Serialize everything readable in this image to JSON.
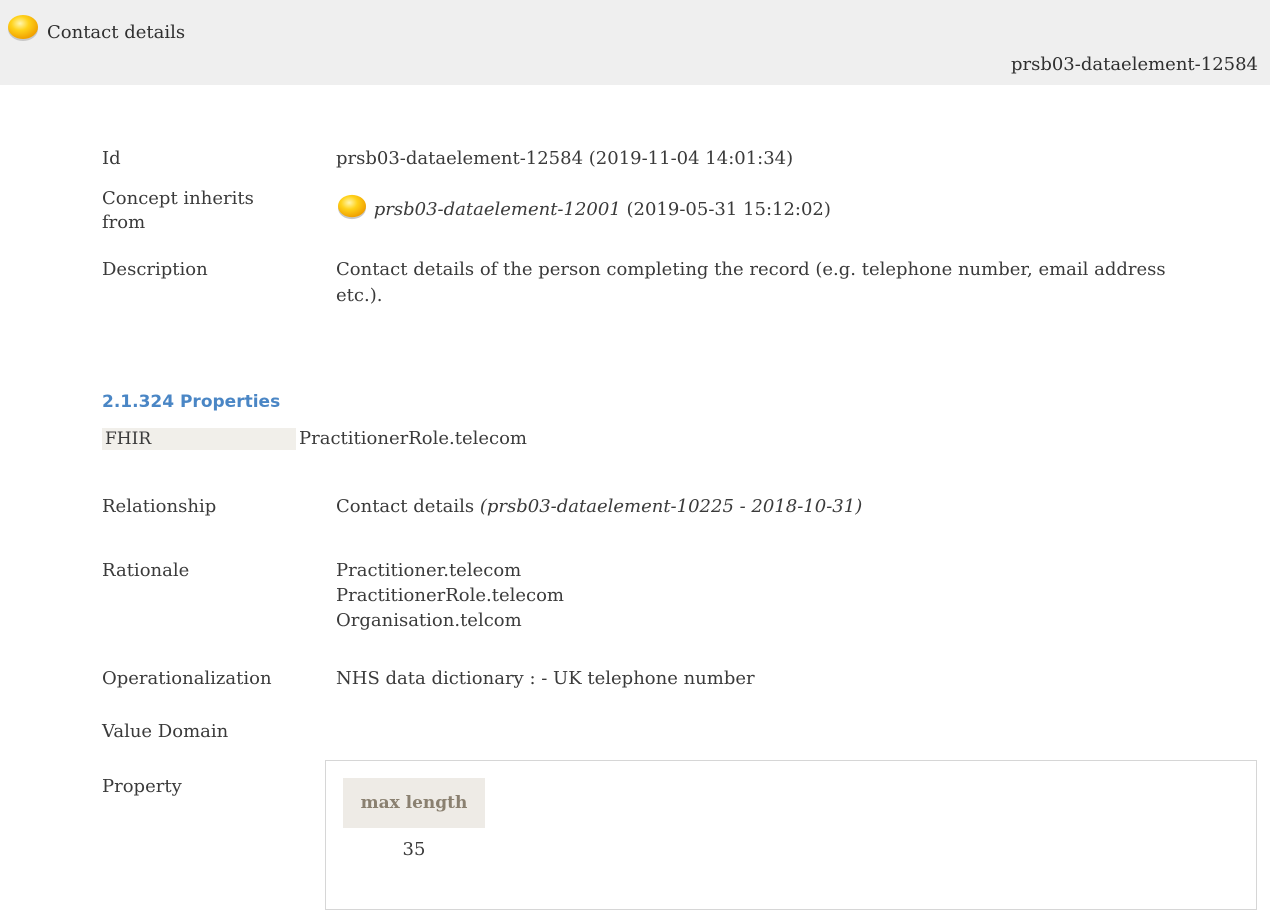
{
  "header": {
    "title": "Contact details",
    "right_id": "prsb03-dataelement-12584",
    "status_icon": "status-orb-yellow-icon"
  },
  "concept": {
    "id_label": "Id",
    "id_value": "prsb03-dataelement-12584 (2019-11-04 14:01:34)",
    "inherits_label": "Concept inherits from",
    "inherits_id": "prsb03-dataelement-12001",
    "inherits_date": "(2019-05-31 15:12:02)",
    "description_label": "Description",
    "description_value": "Contact details of the person completing the record (e.g. telephone number, email address etc.)."
  },
  "properties": {
    "section_title": "2.1.324 Properties",
    "fhir_label": "FHIR",
    "fhir_value": "PractitionerRole.telecom",
    "relationship_label": "Relationship",
    "relationship_value": "Contact details",
    "relationship_ref": "(prsb03-dataelement-10225 - 2018-10-31)",
    "rationale_label": "Rationale",
    "rationale_lines": [
      "Practitioner.telecom",
      "PractitionerRole.telecom",
      "Organisation.telcom"
    ],
    "operationalization_label": "Operationalization",
    "operationalization_value": "NHS data dictionary : - UK telephone number",
    "value_domain_label": "Value Domain",
    "property_label": "Property",
    "property_table": {
      "header": "max length",
      "value": "35"
    }
  },
  "colors": {
    "header_bg": "#efefef",
    "section_title": "#4a86c5",
    "orb_yellow": "#ffc400"
  }
}
